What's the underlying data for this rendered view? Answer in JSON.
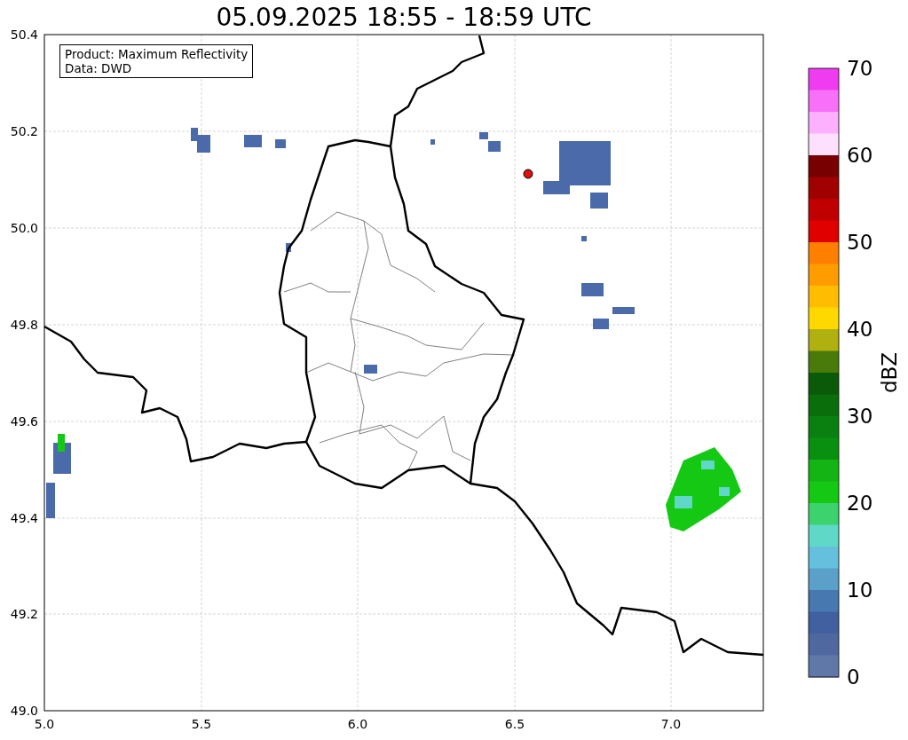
{
  "title": "05.09.2025 18:55 - 18:59 UTC",
  "info_box": {
    "lines": [
      "Product: Maximum Reflectivity",
      "Data: DWD"
    ]
  },
  "axes": {
    "yticks": [
      "50.4",
      "50.2",
      "50.0",
      "49.8",
      "49.6",
      "49.4",
      "49.2",
      "49.0"
    ],
    "xticks": [
      "5.0",
      "5.5",
      "6.0",
      "6.5",
      "7.0"
    ]
  },
  "colorbar": {
    "label": "dBZ",
    "ticks": [
      "70",
      "60",
      "50",
      "40",
      "30",
      "20",
      "10",
      "0"
    ],
    "steps": [
      {
        "color": "#f03cf0"
      },
      {
        "color": "#f870f8"
      },
      {
        "color": "#fdb0fd"
      },
      {
        "color": "#fde0fd"
      },
      {
        "color": "#780000"
      },
      {
        "color": "#a00000"
      },
      {
        "color": "#c00000"
      },
      {
        "color": "#e00000"
      },
      {
        "color": "#ff7f00"
      },
      {
        "color": "#ff9c00"
      },
      {
        "color": "#ffbc00"
      },
      {
        "color": "#ffd800"
      },
      {
        "color": "#b0b010"
      },
      {
        "color": "#4a7a0a"
      },
      {
        "color": "#0a5a0a"
      },
      {
        "color": "#0a6e0a"
      },
      {
        "color": "#0a8010"
      },
      {
        "color": "#0a9010"
      },
      {
        "color": "#14b414"
      },
      {
        "color": "#14c814"
      },
      {
        "color": "#3cd26e"
      },
      {
        "color": "#60d8c8"
      },
      {
        "color": "#64c0dc"
      },
      {
        "color": "#5aa0c8"
      },
      {
        "color": "#4878b0"
      },
      {
        "color": "#4060a0"
      },
      {
        "color": "#5068a0"
      },
      {
        "color": "#6078a8"
      }
    ]
  }
}
